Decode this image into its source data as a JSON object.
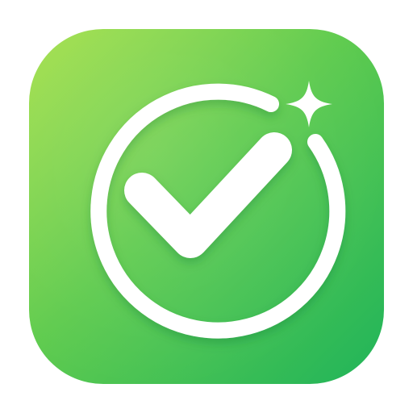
{
  "icon": {
    "name": "checkmark-app-icon",
    "description_glyphs": [
      "check-circle-icon",
      "sparkle-icon"
    ],
    "colors": {
      "background_top_left": "#A6E04C",
      "background_mid": "#5FCB4E",
      "background_bottom_right": "#20B45A",
      "glyph": "#FFFFFF",
      "page_background": "#FFFFFF"
    }
  }
}
